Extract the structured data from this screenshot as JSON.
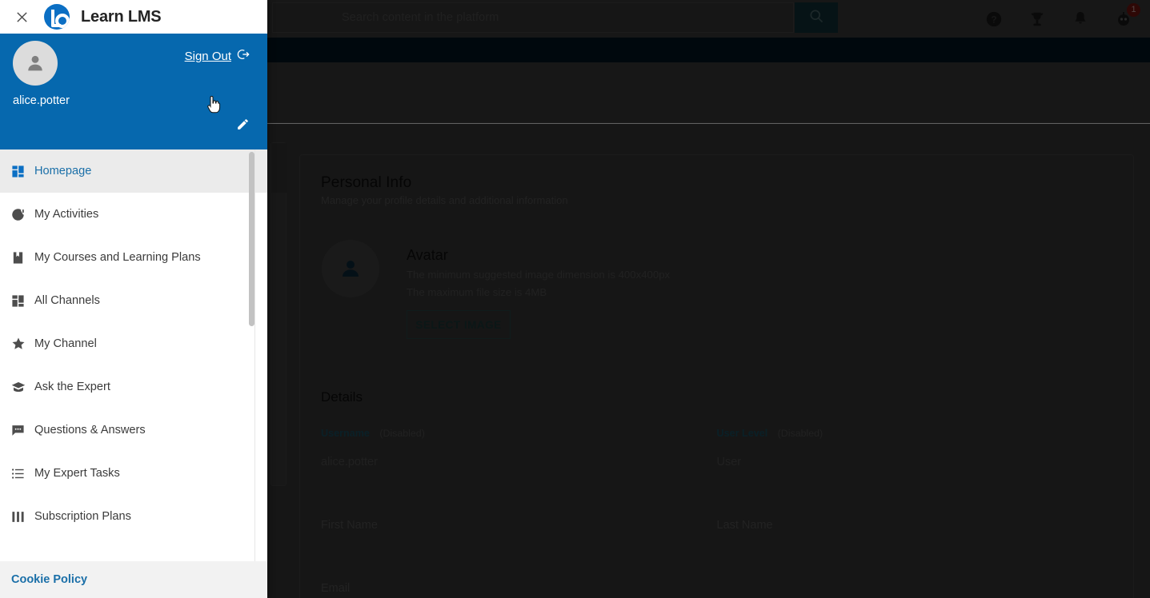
{
  "topbar": {
    "search_placeholder": "Search content in the platform",
    "icons": [
      {
        "name": "search-icon",
        "label": "Search"
      },
      {
        "name": "help-icon",
        "label": "Help"
      },
      {
        "name": "trophy-icon",
        "label": "Gamification"
      },
      {
        "name": "bell-icon",
        "label": "Notifications"
      },
      {
        "name": "bot-avatar-icon",
        "label": "Assistant"
      }
    ],
    "badge_count": "1"
  },
  "drawer": {
    "close_label": "Close",
    "brand": "Learn LMS",
    "logo_name": "learn-lms-logo",
    "user": {
      "username": "alice.potter",
      "sign_out_label": "Sign Out",
      "edit_label": "Edit profile"
    },
    "menu": [
      {
        "label": "Homepage",
        "icon": "dashboard-icon",
        "active": true
      },
      {
        "label": "My Activities",
        "icon": "activity-circle-icon",
        "active": false
      },
      {
        "label": "My Courses and Learning Plans",
        "icon": "book-icon",
        "active": false
      },
      {
        "label": "All Channels",
        "icon": "grid-icon",
        "active": false
      },
      {
        "label": "My Channel",
        "icon": "star-icon",
        "active": false
      },
      {
        "label": "Ask the Expert",
        "icon": "graduation-cap-icon",
        "active": false
      },
      {
        "label": "Questions & Answers",
        "icon": "chat-bubble-icon",
        "active": false
      },
      {
        "label": "My Expert Tasks",
        "icon": "list-icon",
        "active": false
      },
      {
        "label": "Subscription Plans",
        "icon": "columns-icon",
        "active": false
      }
    ],
    "footer": {
      "cookie_policy": "Cookie Policy"
    }
  },
  "main": {
    "personal_info": {
      "title": "Personal Info",
      "subtitle": "Manage your profile details and additional information"
    },
    "avatar": {
      "title": "Avatar",
      "line1": "The minimum suggested image dimension is 400x400px",
      "line2": "The maximum file size is 4MB",
      "button": "SELECT IMAGE"
    },
    "details": {
      "title": "Details",
      "disabled_tag": "(Disabled)",
      "fields": [
        {
          "label": "Username",
          "value": "alice.potter",
          "disabled": true
        },
        {
          "label": "User Level",
          "value": "User",
          "disabled": true
        },
        {
          "label": "First Name",
          "placeholder": "First Name"
        },
        {
          "label": "Last Name",
          "placeholder": "Last Name"
        },
        {
          "label": "Email",
          "placeholder": "Email"
        }
      ]
    }
  },
  "colors": {
    "brand_blue": "#0668AE",
    "navy_band": "#001524",
    "accent_teal": "#12343A",
    "badge_red": "#B3231E",
    "link_blue": "#1A6FA8"
  }
}
